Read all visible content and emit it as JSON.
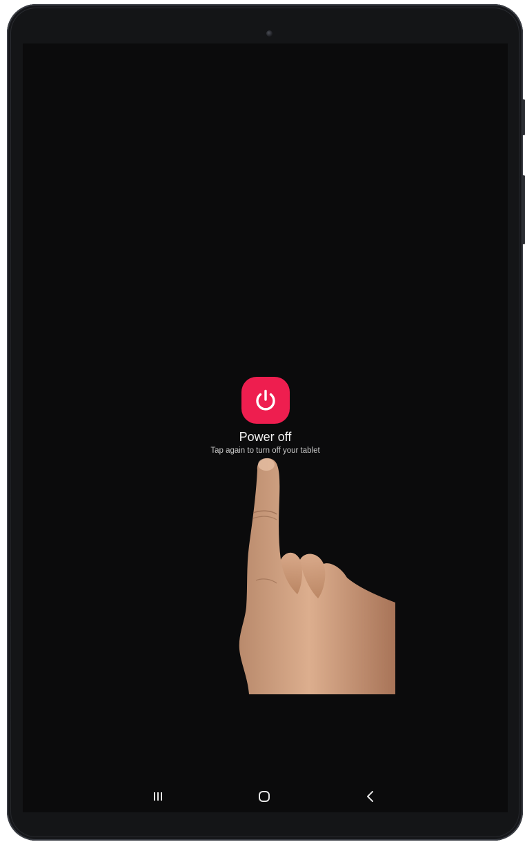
{
  "dialog": {
    "title": "Power off",
    "subtitle": "Tap again to turn off your tablet",
    "icon": "power-icon",
    "accent_color": "#ee1e4f"
  },
  "navigation_bar": {
    "buttons": [
      {
        "name": "recent-apps",
        "icon": "recent-apps-icon"
      },
      {
        "name": "home",
        "icon": "home-icon"
      },
      {
        "name": "back",
        "icon": "back-icon"
      }
    ]
  },
  "colors": {
    "screen_background": "#0b0b0c",
    "device_frame": "#1d1f23",
    "nav_icon": "#e6e6e6"
  }
}
